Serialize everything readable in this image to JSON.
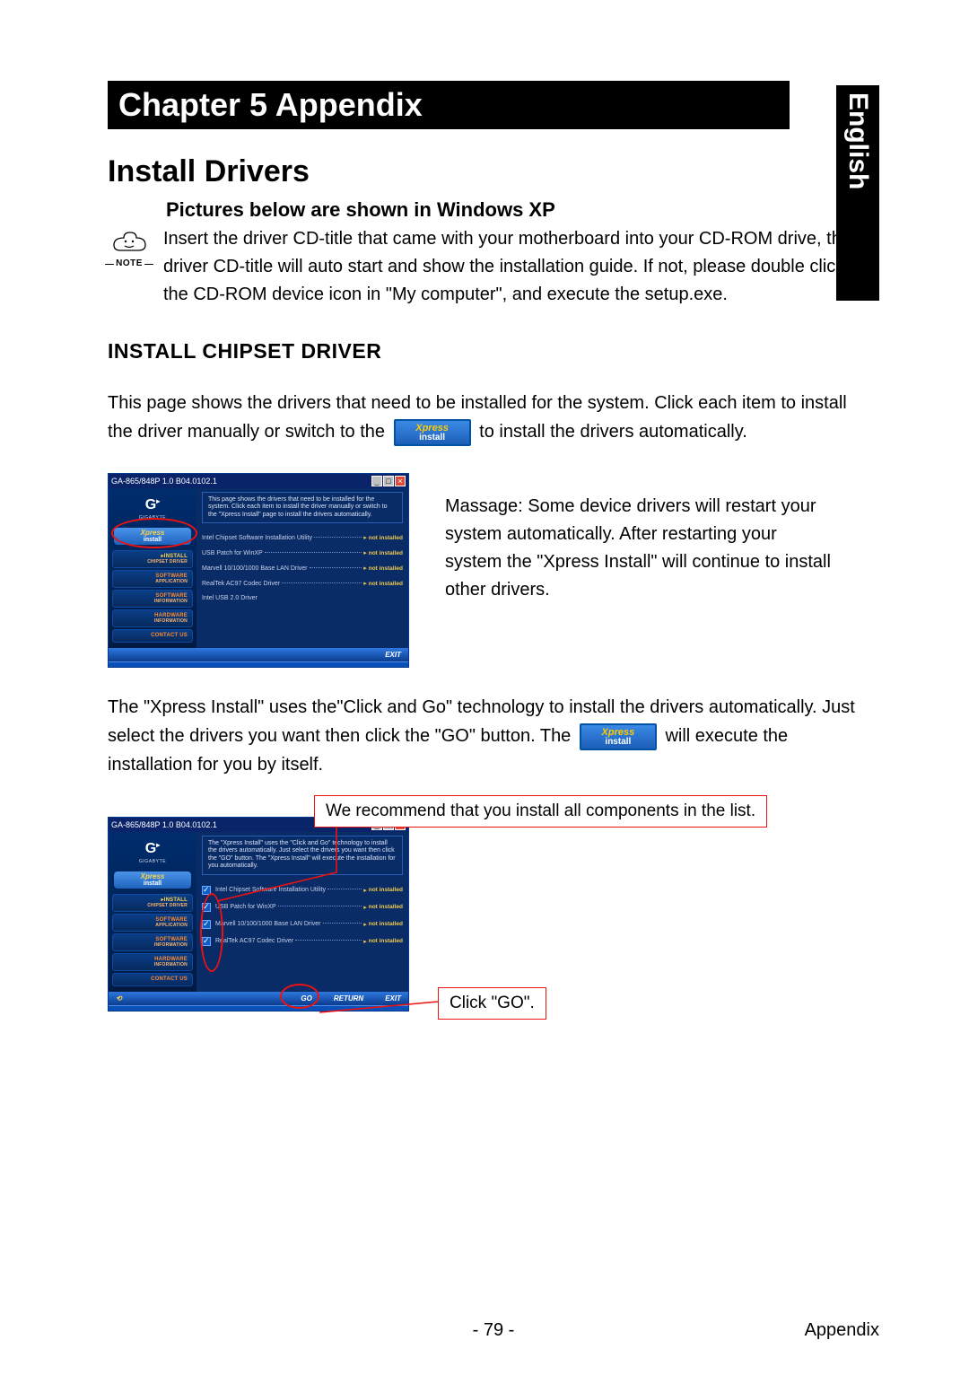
{
  "language_tab": "English",
  "chapter_title": "Chapter 5 Appendix",
  "section_title": "Install Drivers",
  "note_label": "NOTE",
  "subheading_os": "Pictures below are shown in Windows XP",
  "intro_text": "Insert the driver CD-title that came with your motherboard into your CD-ROM drive, the driver CD-title will auto start and show the installation guide. If not, please double click the CD-ROM device icon in \"My computer\", and execute the setup.exe.",
  "install_chipset_heading": "INSTALL CHIPSET DRIVER",
  "para1_before": "This page shows the drivers that need to be installed for the system. Click each item  to install the driver manually or switch to the ",
  "para1_after": " to install the drivers automatically.",
  "xpress_badge_l1": "Xpress",
  "xpress_badge_l2": "install",
  "message_text": "Massage: Some device drivers will restart your system automatically. After restarting your system the \"Xpress Install\" will continue to install other drivers.",
  "para2_before": "The \"Xpress Install\" uses the\"Click and Go\" technology to install the drivers automatically. Just select the drivers you want then click the \"GO\" button. The ",
  "para2_after": " will execute the installation for you by itself.",
  "callout_top": "We recommend that you install all components in the list.",
  "callout_go": "Click \"GO\".",
  "page_number": "- 79 -",
  "footer_right": "Appendix",
  "installer": {
    "title": "GA-865/848P 1.0 B04.0102.1",
    "desc1": "This page shows the drivers that need to be installed for the system. Click each item to install the driver manually or switch to the \"Xpress Install\" page to install the drivers automatically.",
    "desc2": "The \"Xpress Install\" uses the \"Click and Go\" technology to install the drivers automatically. Just select the drivers you want then click the \"GO\" button. The \"Xpress Install\" will execute the installation for you automatically.",
    "logo_sub": "GIGABYTE",
    "sidebar": [
      {
        "label": "▸INSTALL",
        "sub": "CHIPSET DRIVER",
        "cls": "inst"
      },
      {
        "label": "SOFTWARE",
        "sub": "APPLICATION",
        "cls": ""
      },
      {
        "label": "SOFTWARE",
        "sub": "INFORMATION",
        "cls": ""
      },
      {
        "label": "HARDWARE",
        "sub": "INFORMATION",
        "cls": ""
      },
      {
        "label": "CONTACT US",
        "sub": "",
        "cls": ""
      }
    ],
    "drivers": [
      {
        "name": "Intel Chipset Software Installation Utility",
        "status": "not installed"
      },
      {
        "name": "USB Patch for WinXP",
        "status": "not installed"
      },
      {
        "name": "Marvell 10/100/1000 Base LAN Driver",
        "status": "not installed"
      },
      {
        "name": "RealTek AC97 Codec Driver",
        "status": "not installed"
      },
      {
        "name": "Intel USB 2.0 Driver",
        "status": ""
      }
    ],
    "buttons": {
      "go": "GO",
      "return": "RETURN",
      "exit": "EXIT"
    }
  }
}
